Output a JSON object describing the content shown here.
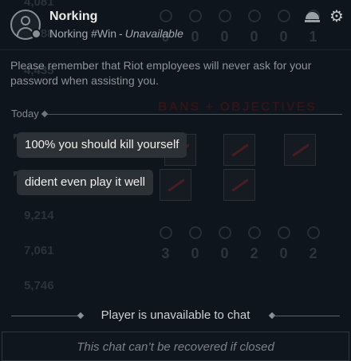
{
  "header": {
    "name": "Norking",
    "riot_id": "Norking #Win",
    "separator": "-",
    "status": "Unavailable",
    "minimize_icon": "minimize-icon",
    "settings_icon": "gear-icon",
    "gear_glyph": "⚙"
  },
  "warning": {
    "text": "Please remember that Riot employees will never ask for your password when assisting you."
  },
  "conversation": {
    "day_label": "Today",
    "messages": [
      {
        "text": "100% you should kill yourself"
      },
      {
        "text": "dident even play it well"
      }
    ],
    "unavailable_notice": "Player is unavailable to chat"
  },
  "footer": {
    "notice": "This chat can’t be recovered if closed"
  },
  "background": {
    "title": "BANS + OBJECTIVES",
    "numbers": [
      "4,081",
      "4,588",
      "4,435",
      "9,214",
      "7,061",
      "5,746"
    ],
    "top_values": [
      "0",
      "0",
      "0",
      "0",
      "0",
      "1"
    ],
    "bottom_values": [
      "3",
      "0",
      "0",
      "2",
      "0",
      "2"
    ]
  },
  "colors": {
    "background": "#0e151c",
    "bubble": "#2b3135",
    "text_primary": "#f1efeb",
    "text_muted": "#8c949a"
  }
}
